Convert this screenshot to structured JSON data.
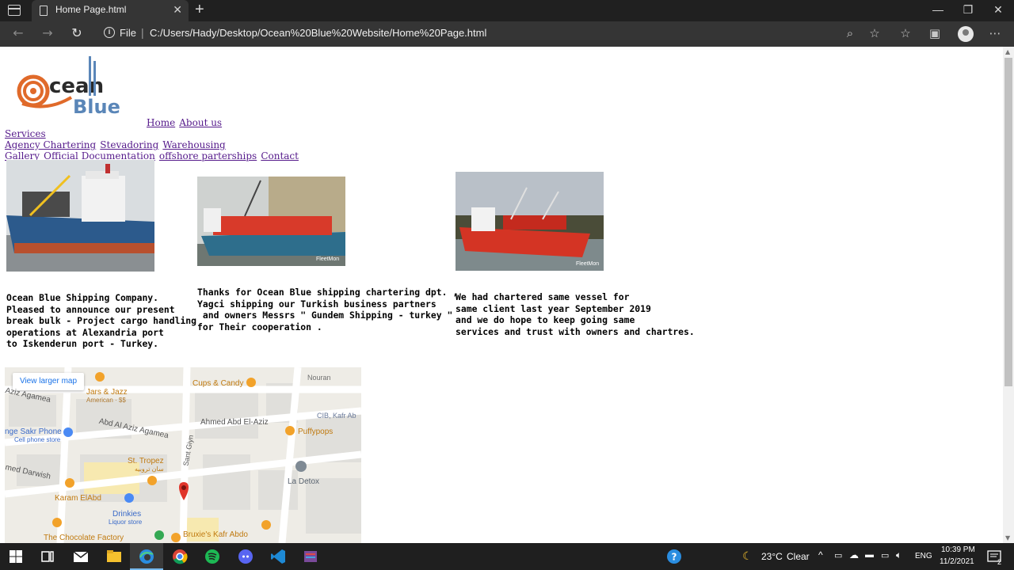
{
  "browser": {
    "tab_title": "Home Page.html",
    "address_scheme": "File",
    "address_url": "C:/Users/Hady/Desktop/Ocean%20Blue%20Website/Home%20Page.html"
  },
  "site": {
    "logo_text_top": "cean",
    "logo_text_bottom": "Blue",
    "nav": {
      "home": "Home",
      "about": "About us",
      "services": "Services",
      "agency": "Agency Chartering",
      "stevadoring": "Stevadoring",
      "warehousing": "Warehousing",
      "gallery": "Gallery",
      "official_docs": "Official Documentation",
      "offshore": "offshore parterships",
      "contact": "Contact"
    },
    "posts": [
      {
        "text": "Ocean Blue Shipping Company.\nPleased to announce our present\nbreak bulk - Project cargo handling\noperations at Alexandria port\nto Iskenderun port - Turkey."
      },
      {
        "text": "Thanks for Ocean Blue shipping chartering dpt. ,\nYagci shipping our Turkish business partners\n and owners Messrs \" Gundem Shipping - turkey \"\nfor Their cooperation ."
      },
      {
        "text": "We had chartered same vessel for\nsame client last year September 2019\nand we do hope to keep going same\nservices and trust with owners and chartres."
      }
    ],
    "photo_watermark": "FleetMon",
    "map": {
      "view_larger": "View larger map",
      "labels": [
        "Jars & Jazz",
        "American · $$",
        "Cups & Candy",
        "Nouran",
        "CIB, Kafr Ab",
        "Ahmed Abd El-Aziz",
        "Puffypops",
        "nge Sakr Phone",
        "Cell phone store",
        "Abd Al Aziz Agamea",
        "Aziz Agamea",
        "St. Tropez",
        "سان تروبيه",
        "La Detox",
        "med Darwish",
        "Karam ElAbd",
        "Drinkies",
        "Liquor store",
        "Bruxie's Kafr Abdo",
        "The Chocolate Factory",
        "Sant Giyn"
      ]
    }
  },
  "taskbar": {
    "weather_temp": "23°C",
    "weather_desc": "Clear",
    "lang": "ENG",
    "time": "10:39 PM",
    "date": "11/2/2021",
    "notifications": "2"
  }
}
